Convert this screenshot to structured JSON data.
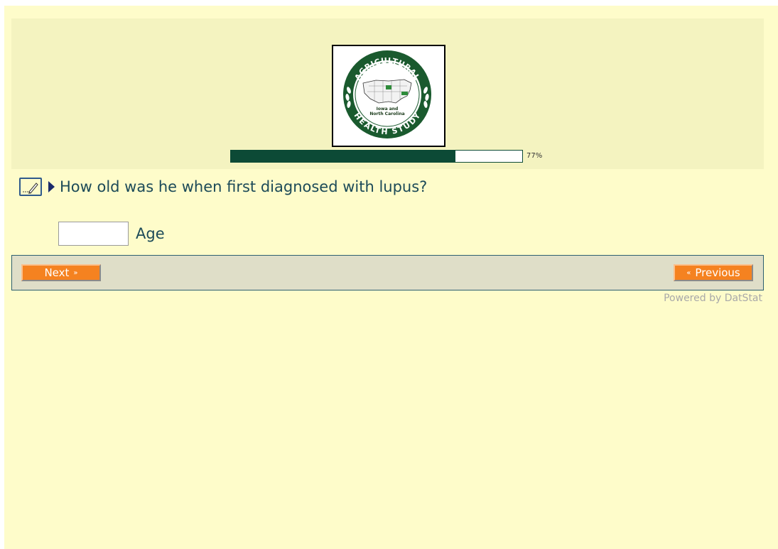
{
  "logo": {
    "arc_top": "AGRICULTURAL",
    "arc_bottom": "HEALTH STUDY",
    "center_line1": "Iowa and",
    "center_line2": "North Carolina"
  },
  "progress": {
    "percent": 77,
    "label": "77%"
  },
  "question": {
    "text": "How old was he when first diagnosed with lupus?",
    "input_value": "",
    "input_label": "Age"
  },
  "nav": {
    "next_label": "Next",
    "next_glyph": "»",
    "previous_label": "Previous",
    "previous_glyph": "«"
  },
  "footer": {
    "powered_by": "Powered by DatStat"
  },
  "colors": {
    "page_bg": "#fefcca",
    "header_bg": "#f4f3c0",
    "progress_fill": "#0c4a36",
    "button_orange": "#f58220",
    "text_teal": "#1c4a58"
  }
}
